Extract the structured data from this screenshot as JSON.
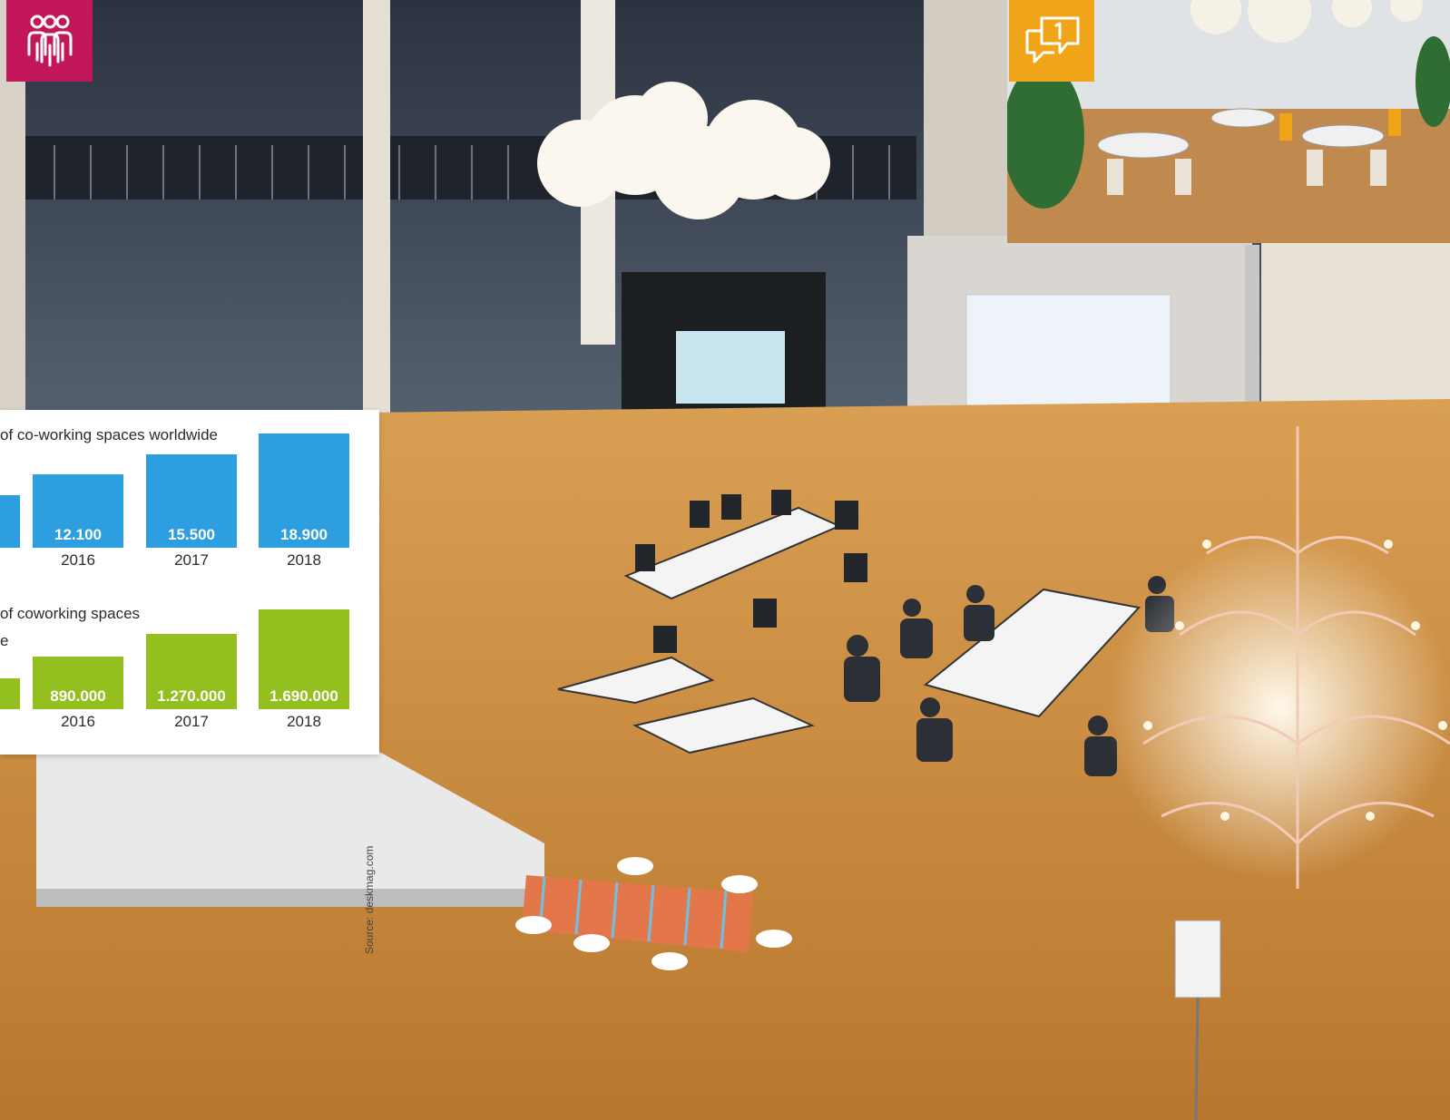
{
  "icons": {
    "people": "people-group-icon",
    "chat": "chat-bubbles-icon"
  },
  "colors": {
    "people_badge": "#c2185b",
    "chat_badge": "#f0a418",
    "series1": "#2d9fe0",
    "series2": "#93c01f"
  },
  "chart_data": [
    {
      "type": "bar",
      "title": "of co-working spaces worldwide",
      "categories": [
        "",
        "2016",
        "2017",
        "2018"
      ],
      "values": [
        null,
        12100,
        15500,
        18900
      ],
      "value_labels": [
        "",
        "12.100",
        "15.500",
        "18.900"
      ],
      "color": "#2d9fe0"
    },
    {
      "type": "bar",
      "title": "of coworking spaces",
      "title_line2": "e",
      "categories": [
        "",
        "2016",
        "2017",
        "2018"
      ],
      "values": [
        null,
        890000,
        1270000,
        1690000
      ],
      "value_labels": [
        "",
        "890.000",
        "1.270.000",
        "1.690.000"
      ],
      "color": "#93c01f"
    }
  ],
  "source": "Source: deskmag.com"
}
